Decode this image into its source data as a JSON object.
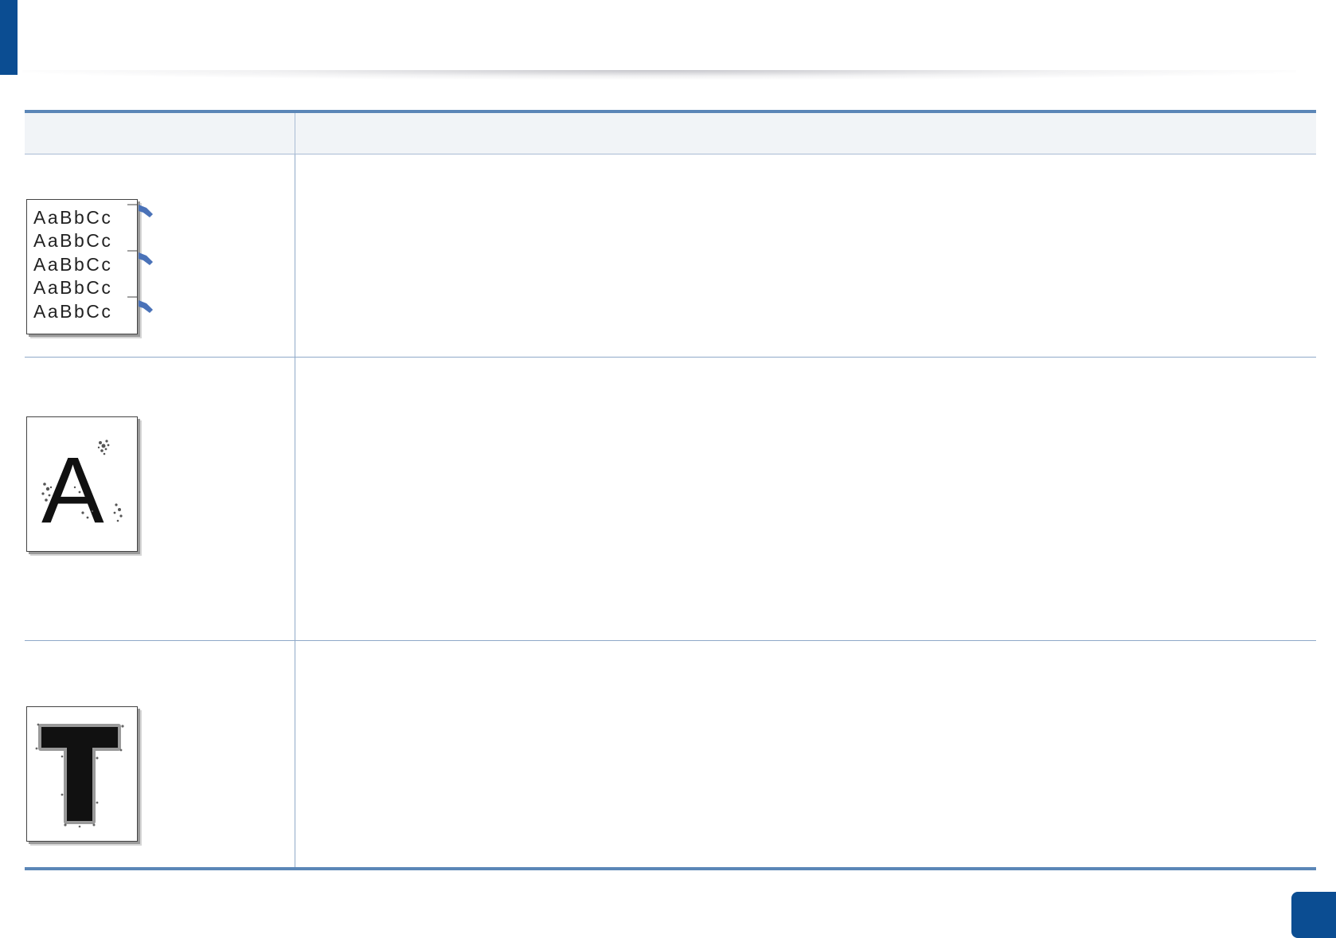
{
  "header": {
    "accent_color": "#0b4d92"
  },
  "table": {
    "header_cells": [
      "",
      ""
    ],
    "border_color": "#5b86b7",
    "rows": [
      {
        "sample_icon": "repeated-text-defect-icon",
        "sample_lines": [
          "AaBbCc",
          "AaBbCc",
          "AaBbCc",
          "AaBbCc",
          "AaBbCc"
        ],
        "description": ""
      },
      {
        "sample_icon": "background-scatter-defect-icon",
        "sample_glyph": "A",
        "description": ""
      },
      {
        "sample_icon": "toner-particles-defect-icon",
        "sample_glyph": "T",
        "description": ""
      }
    ]
  },
  "footer": {
    "page_number": ""
  }
}
